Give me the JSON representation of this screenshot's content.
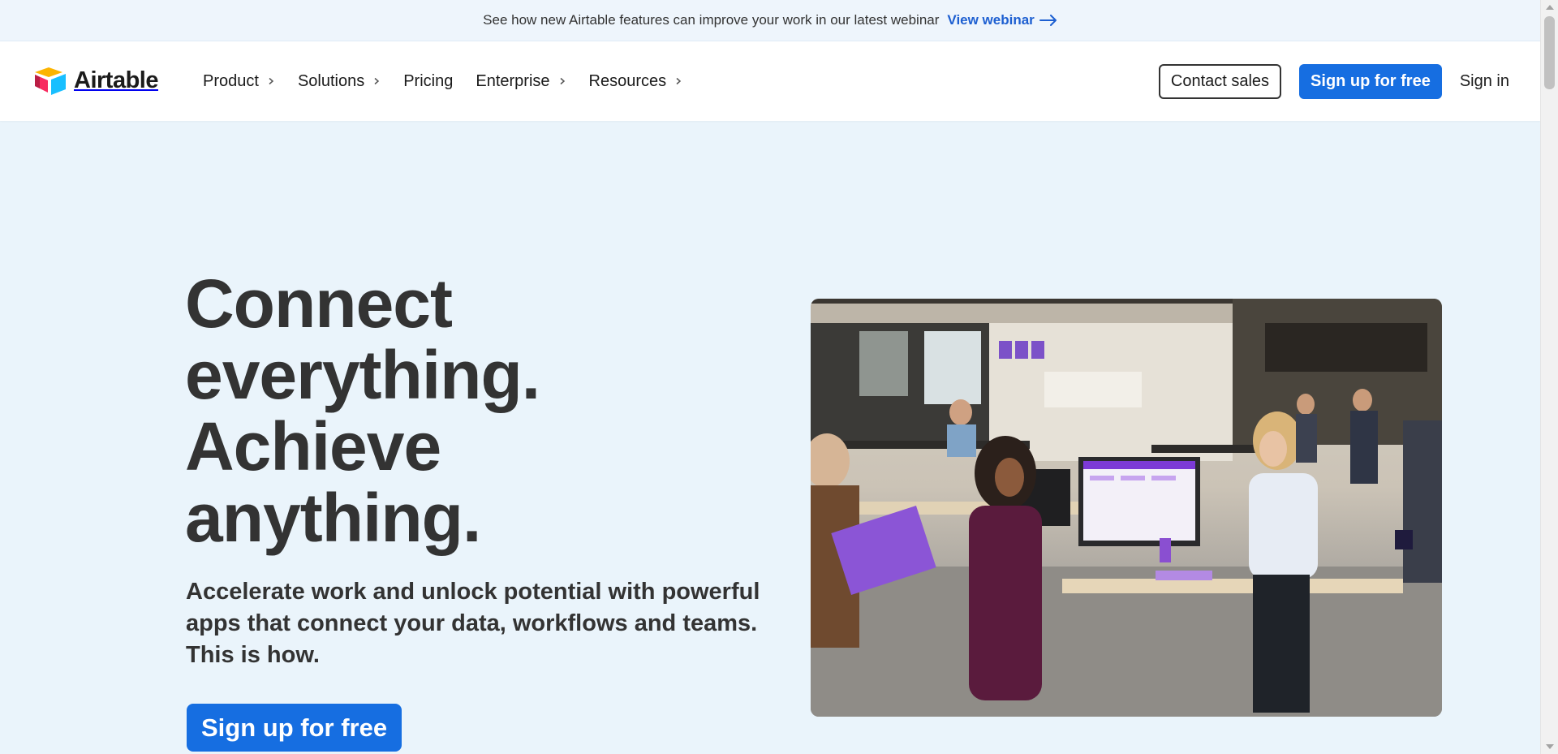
{
  "banner": {
    "message": "See how new Airtable features can improve your work in our latest webinar",
    "link_label": "View webinar",
    "link_icon": "arrow-right-icon"
  },
  "header": {
    "logo_text": "Airtable",
    "nav": [
      {
        "label": "Product",
        "has_submenu": true
      },
      {
        "label": "Solutions",
        "has_submenu": true
      },
      {
        "label": "Pricing",
        "has_submenu": false
      },
      {
        "label": "Enterprise",
        "has_submenu": true
      },
      {
        "label": "Resources",
        "has_submenu": true
      }
    ],
    "contact_sales": "Contact sales",
    "signup": "Sign up for free",
    "signin": "Sign in"
  },
  "hero": {
    "title_lines": [
      "Connect",
      "everything.",
      "Achieve",
      "anything."
    ],
    "subtitle": "Accelerate work and unlock potential with powerful apps that connect your data, workflows and teams. This is how.",
    "cta": "Sign up for free"
  },
  "colors": {
    "brand_blue": "#166ee1",
    "hero_bg": "#eaf4fb",
    "banner_bg": "#eef5fc",
    "text_dark": "#333333"
  }
}
